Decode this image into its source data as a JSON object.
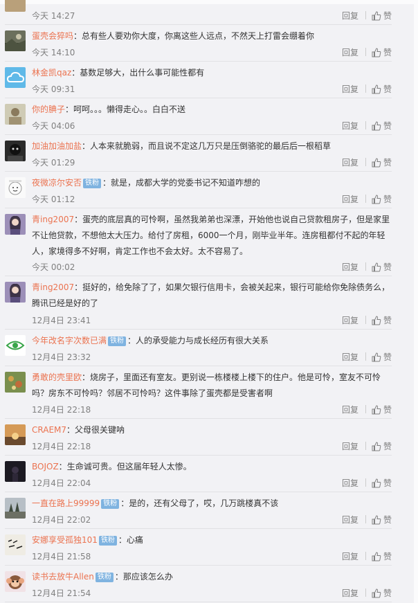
{
  "actions": {
    "reply": "回复",
    "like": "赞"
  },
  "badge_label": "铁粉",
  "comments": [
    {
      "user": "",
      "sep": "",
      "text": "",
      "time": "今天 14:27",
      "badge": false,
      "avatar": "partial"
    },
    {
      "user": "蛋壳会猝吗",
      "sep": "：",
      "text": "总有些人要劝你大度，你离这些人远点，不然天上打雷会绷着你",
      "time": "今天 14:10",
      "badge": false,
      "avatar": "landscape"
    },
    {
      "user": "林金凯qaz",
      "sep": "：",
      "text": "基数足够大，出什么事可能性都有",
      "time": "今天 09:31",
      "badge": false,
      "avatar": "cloud"
    },
    {
      "user": "你的腆子",
      "sep": "：",
      "text": "呵呵。。。懒得走心。。白白不送",
      "time": "今天 04:06",
      "badge": false,
      "avatar": "photo"
    },
    {
      "user": "加油加油加盐",
      "sep": "：",
      "text": "人本来就脆弱，而且说不定这几万只是压倒骆驼的最后后一根稻草",
      "time": "今天 01:29",
      "badge": false,
      "avatar": "dark"
    },
    {
      "user": "夜微凉尔安否",
      "sep": "：",
      "text": "就是，成都大学的党委书记不知道咋想的",
      "time": "今天 01:12",
      "badge": true,
      "avatar": "sketch"
    },
    {
      "user": "青ing2007",
      "sep": "：",
      "text": "蛋壳的底层真的可怜啊，虽然我弟弟也深漂，开始他也说自己贷款租房子，但是家里不让他贷款，不想他太大压力。给付了房租，6000一个月，刚毕业半年。连房租都付不起的年轻人，家境得多不好啊，肯定工作也不会太好。太不容易了。",
      "time": "今天 00:02",
      "badge": false,
      "avatar": "girl"
    },
    {
      "user": "青ing2007",
      "sep": "：",
      "text": "挺好的，给免除了了，如果欠银行信用卡，会被关起来，银行可能给你免除债务么，腾讯已经是好的了",
      "time": "12月4日 23:41",
      "badge": false,
      "avatar": "girl"
    },
    {
      "user": "今年改名字次数已满",
      "sep": "：",
      "text": "人的承受能力与成长经历有很大关系",
      "time": "12月4日 23:32",
      "badge": true,
      "avatar": "eye"
    },
    {
      "user": "勇敢的壳里欧",
      "sep": "：",
      "text": "烧房子，里面还有室友。更别说一栋楼楼上楼下的住户。他是可怜，室友不可怜吗？房东不可怜吗？邻居不可怜吗？这件事除了蛋壳都是受害者啊",
      "time": "12月4日 22:18",
      "badge": false,
      "avatar": "flowers"
    },
    {
      "user": "CRAEM7",
      "sep": "：",
      "text": "父母很关键呐",
      "time": "12月4日 22:18",
      "badge": false,
      "avatar": "sunset"
    },
    {
      "user": "BOJOZ",
      "sep": "：",
      "text": "生命诚可贵。但这届年轻人太惨。",
      "time": "12月4日 22:04",
      "badge": false,
      "avatar": "night"
    },
    {
      "user": "一直在路上99999",
      "sep": "：",
      "text": "是的，还有父母了，哎，几万跳楼真不该",
      "time": "12月4日 22:02",
      "badge": true,
      "avatar": "trees"
    },
    {
      "user": "安娜享受孤独101",
      "sep": "：",
      "text": "心痛",
      "time": "12月4日 21:58",
      "badge": true,
      "avatar": "writing"
    },
    {
      "user": "读书去放牛Allen",
      "sep": "：",
      "text": "那应该怎么办",
      "time": "12月4日 21:54",
      "badge": true,
      "avatar": "monkey"
    }
  ]
}
